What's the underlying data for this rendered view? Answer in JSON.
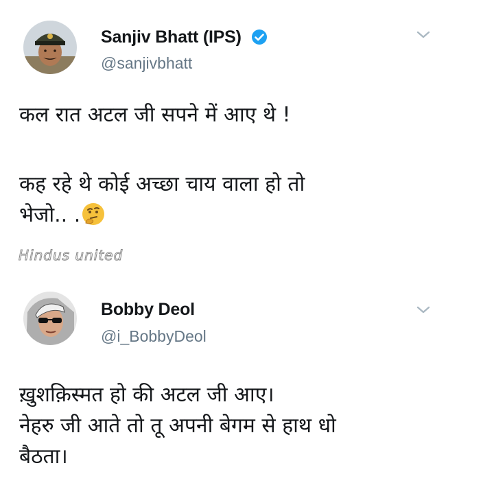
{
  "tweets": [
    {
      "display_name": "Sanjiv Bhatt (IPS)",
      "handle": "@sanjivbhatt",
      "verified": true,
      "avatar_icon": "police-officer-avatar",
      "paragraph_1": "कल रात अटल जी सपने में आए थे !",
      "paragraph_2": "कह रहे थे कोई अच्छा चाय वाला हो तो\nभेजो.. .",
      "emoji": "thinking-face-emoji"
    },
    {
      "display_name": "Bobby Deol",
      "handle": "@i_BobbyDeol",
      "verified": false,
      "avatar_icon": "sunglasses-man-avatar",
      "text": "ख़ुशक़िस्मत हो की अटल जी आए।\nनेहरु जी आते तो तू अपनी बेगम से हाथ धो\nबैठता।"
    }
  ],
  "watermark": "Hindus united",
  "colors": {
    "text": "#14171a",
    "secondary": "#657786",
    "verified_badge": "#1da1f2",
    "chevron": "#aab8c2"
  }
}
